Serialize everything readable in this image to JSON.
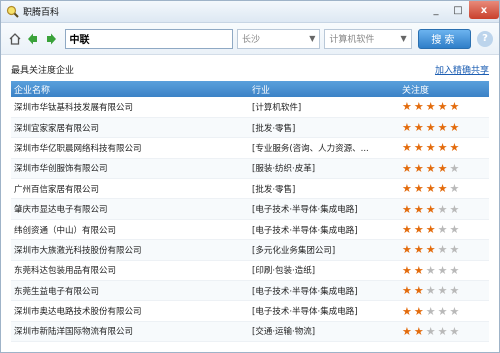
{
  "window": {
    "title": "职腾百科",
    "controls": [
      "_",
      "□",
      "x"
    ]
  },
  "toolbar": {
    "search_value": "中联",
    "location_placeholder": "长沙",
    "category_placeholder": "计算机软件",
    "search_label": "搜索",
    "help_label": "?"
  },
  "section": {
    "title": "最具关注度企业",
    "link": "加入精确共享"
  },
  "table": {
    "headers": [
      "企业名称",
      "行业",
      "关注度"
    ],
    "rows": [
      {
        "name": "深圳市华钛基科技发展有限公司",
        "industry": "[计算机软件]",
        "stars": 5
      },
      {
        "name": "深圳宜家家居有限公司",
        "industry": "[批发·零售]",
        "stars": 5
      },
      {
        "name": "深圳市华亿职晨网络科技有限公司",
        "industry": "[专业服务(咨询、人力资源、...",
        "stars": 5
      },
      {
        "name": "深圳市华创服饰有限公司",
        "industry": "[服装·纺织·皮革]",
        "stars": 4
      },
      {
        "name": "广州百信家居有限公司",
        "industry": "[批发·零售]",
        "stars": 4
      },
      {
        "name": "肇庆市显达电子有限公司",
        "industry": "[电子技术·半导体·集成电路]",
        "stars": 3
      },
      {
        "name": "纬创资通（中山）有限公司",
        "industry": "[电子技术·半导体·集成电路]",
        "stars": 3
      },
      {
        "name": "深圳市大族激光科技股份有限公司",
        "industry": "[多元化业务集团公司]",
        "stars": 3
      },
      {
        "name": "东莞科达包装用品有限公司",
        "industry": "[印刷·包装·造纸]",
        "stars": 2
      },
      {
        "name": "东莞生益电子有限公司",
        "industry": "[电子技术·半导体·集成电路]",
        "stars": 2
      },
      {
        "name": "深圳市奥达电路技术股份有限公司",
        "industry": "[电子技术·半导体·集成电路]",
        "stars": 2
      },
      {
        "name": "深圳市新陆洋国际物流有限公司",
        "industry": "[交通·运输·物流]",
        "stars": 2
      }
    ]
  },
  "colors": {
    "header_blue": "#3b82c6",
    "star_on": "#e36b0c",
    "star_off": "#b9b9b9",
    "link_blue": "#1e5fb3"
  }
}
